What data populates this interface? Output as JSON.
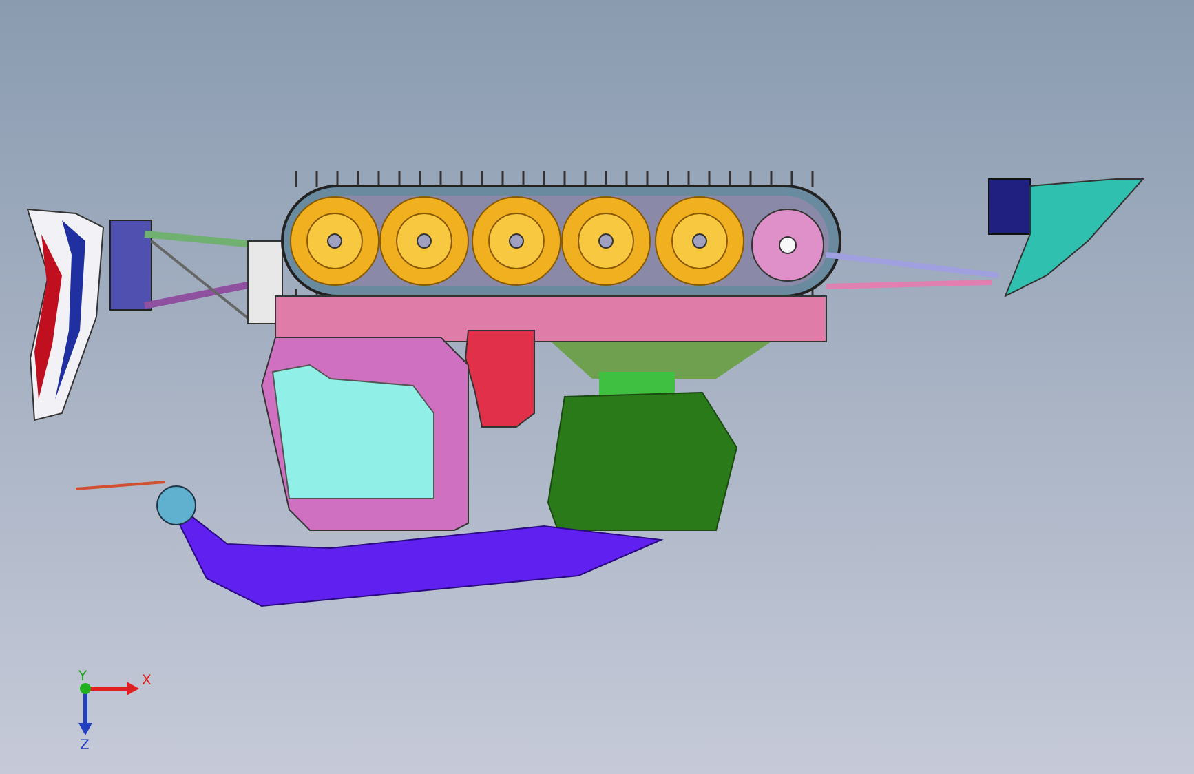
{
  "viewport": {
    "axes": [
      {
        "label": "X"
      },
      {
        "label": "Y"
      },
      {
        "label": "Z"
      }
    ]
  }
}
